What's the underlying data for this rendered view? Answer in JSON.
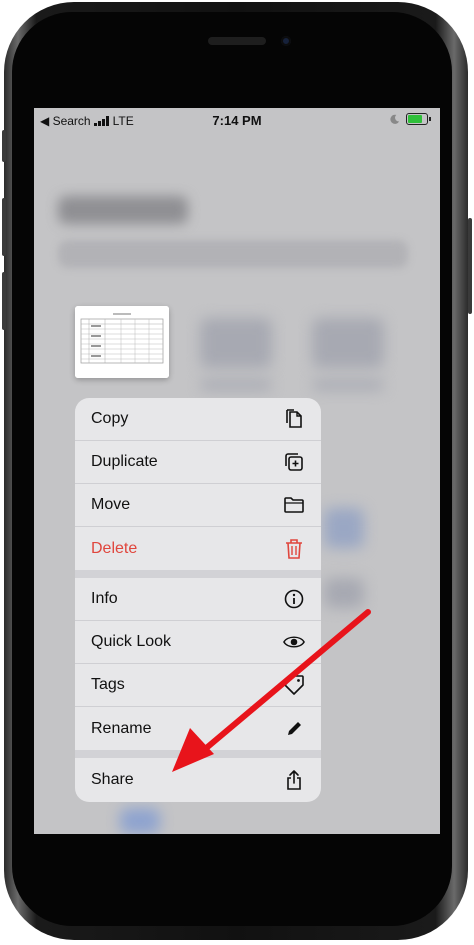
{
  "status_bar": {
    "back_label": "◀ Search",
    "carrier": "LTE",
    "time": "7:14 PM"
  },
  "context_menu": {
    "groups": [
      [
        {
          "label": "Copy",
          "icon": "copy-icon"
        },
        {
          "label": "Duplicate",
          "icon": "duplicate-icon"
        },
        {
          "label": "Move",
          "icon": "folder-icon"
        },
        {
          "label": "Delete",
          "icon": "trash-icon",
          "destructive": true
        }
      ],
      [
        {
          "label": "Info",
          "icon": "info-icon"
        },
        {
          "label": "Quick Look",
          "icon": "eye-icon"
        },
        {
          "label": "Tags",
          "icon": "tag-icon"
        },
        {
          "label": "Rename",
          "icon": "pencil-icon"
        }
      ],
      [
        {
          "label": "Share",
          "icon": "share-icon"
        }
      ]
    ]
  },
  "colors": {
    "destructive": "#e0463d",
    "arrow": "#e8141b",
    "battery": "#2fbf3a"
  }
}
